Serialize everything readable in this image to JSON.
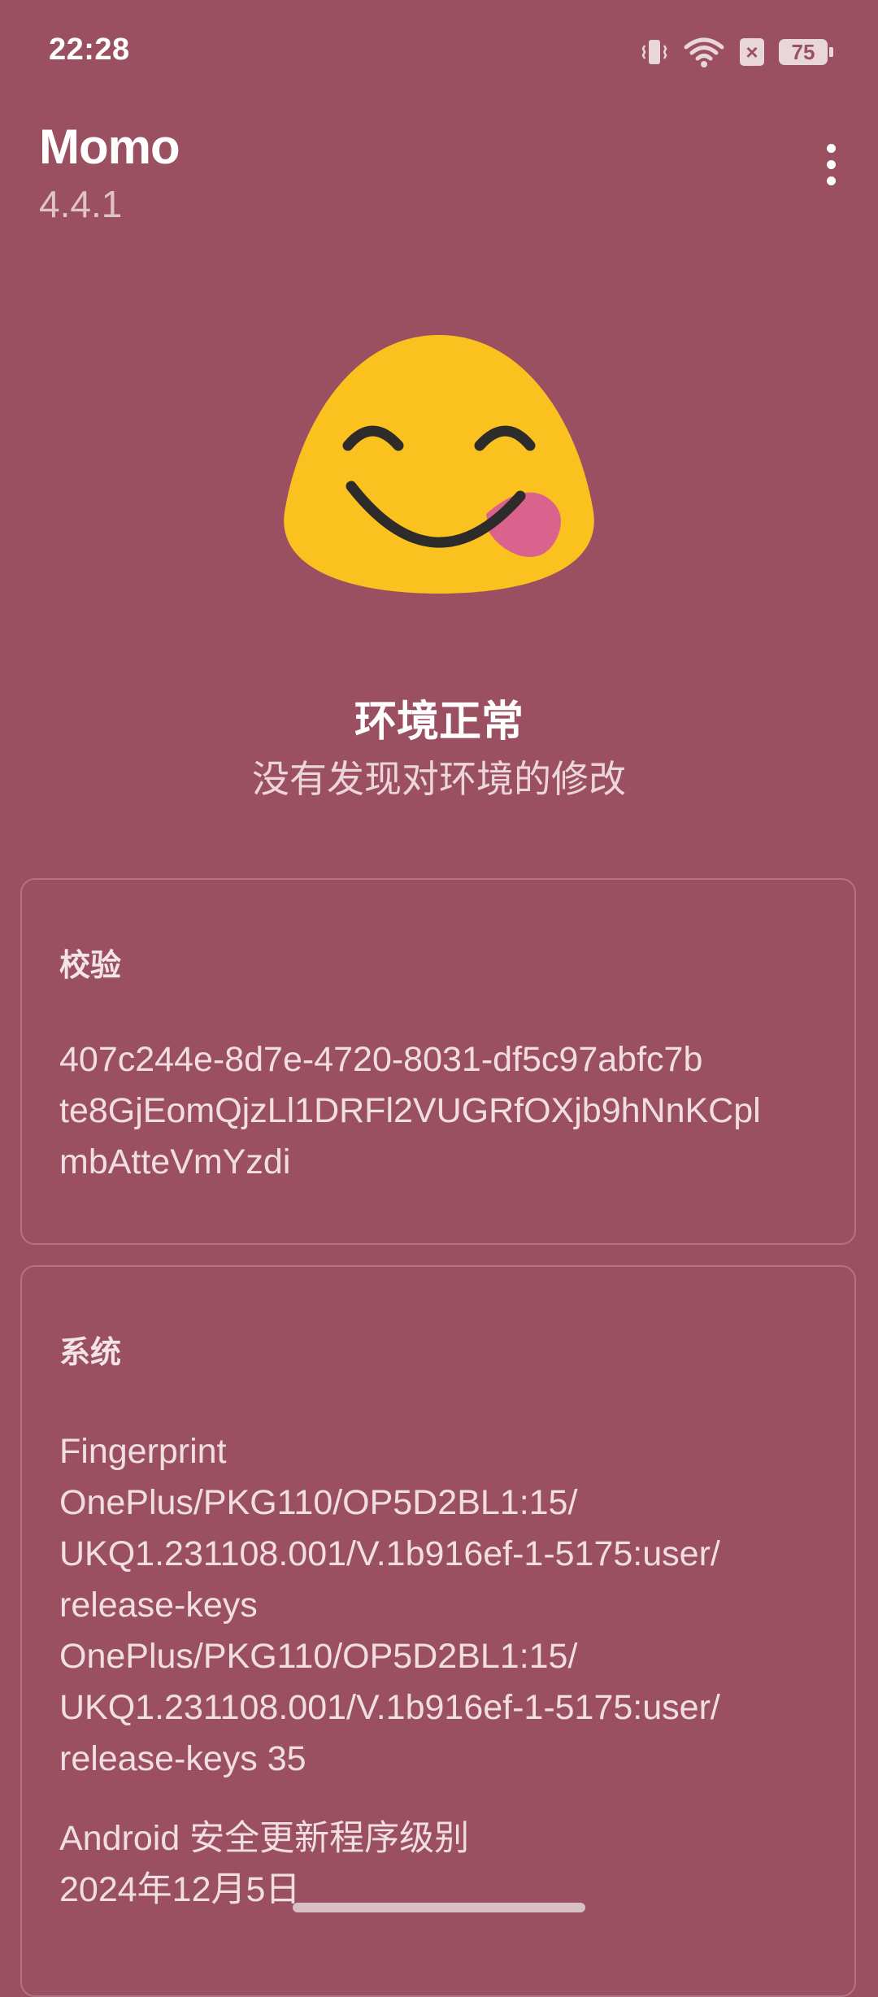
{
  "status_bar": {
    "time": "22:28",
    "battery": "75",
    "sim_icon_glyph": "×",
    "icons": [
      "vibrate-icon",
      "wifi-icon",
      "sim-disabled-icon",
      "battery-icon"
    ]
  },
  "app_bar": {
    "title": "Momo",
    "version": "4.4.1",
    "menu_icon": "more-vert-icon"
  },
  "status": {
    "emoji_icon": "yum-face-icon",
    "title": "环境正常",
    "description": "没有发现对环境的修改"
  },
  "verify_card": {
    "title": "校验",
    "lines": [
      "407c244e-8d7e-4720-8031-df5c97abfc7b",
      "te8GjEomQjzLl1DRFl2VUGRfOXjb9hNnKCpl",
      "mbAtteVmYzdi"
    ]
  },
  "system_card": {
    "title": "系统",
    "fingerprint_lines": [
      "Fingerprint",
      "OnePlus/PKG110/OP5D2BL1:15/",
      "UKQ1.231108.001/V.1b916ef-1-5175:user/",
      "release-keys",
      "OnePlus/PKG110/OP5D2BL1:15/",
      "UKQ1.231108.001/V.1b916ef-1-5175:user/",
      "release-keys 35"
    ],
    "security_patch_lines": [
      "Android 安全更新程序级别",
      "2024年12月5日"
    ]
  },
  "colors": {
    "background": "#9b5062",
    "emoji_face": "#fbc21f",
    "tongue": "#d9638d",
    "card_border": "#b07484"
  }
}
